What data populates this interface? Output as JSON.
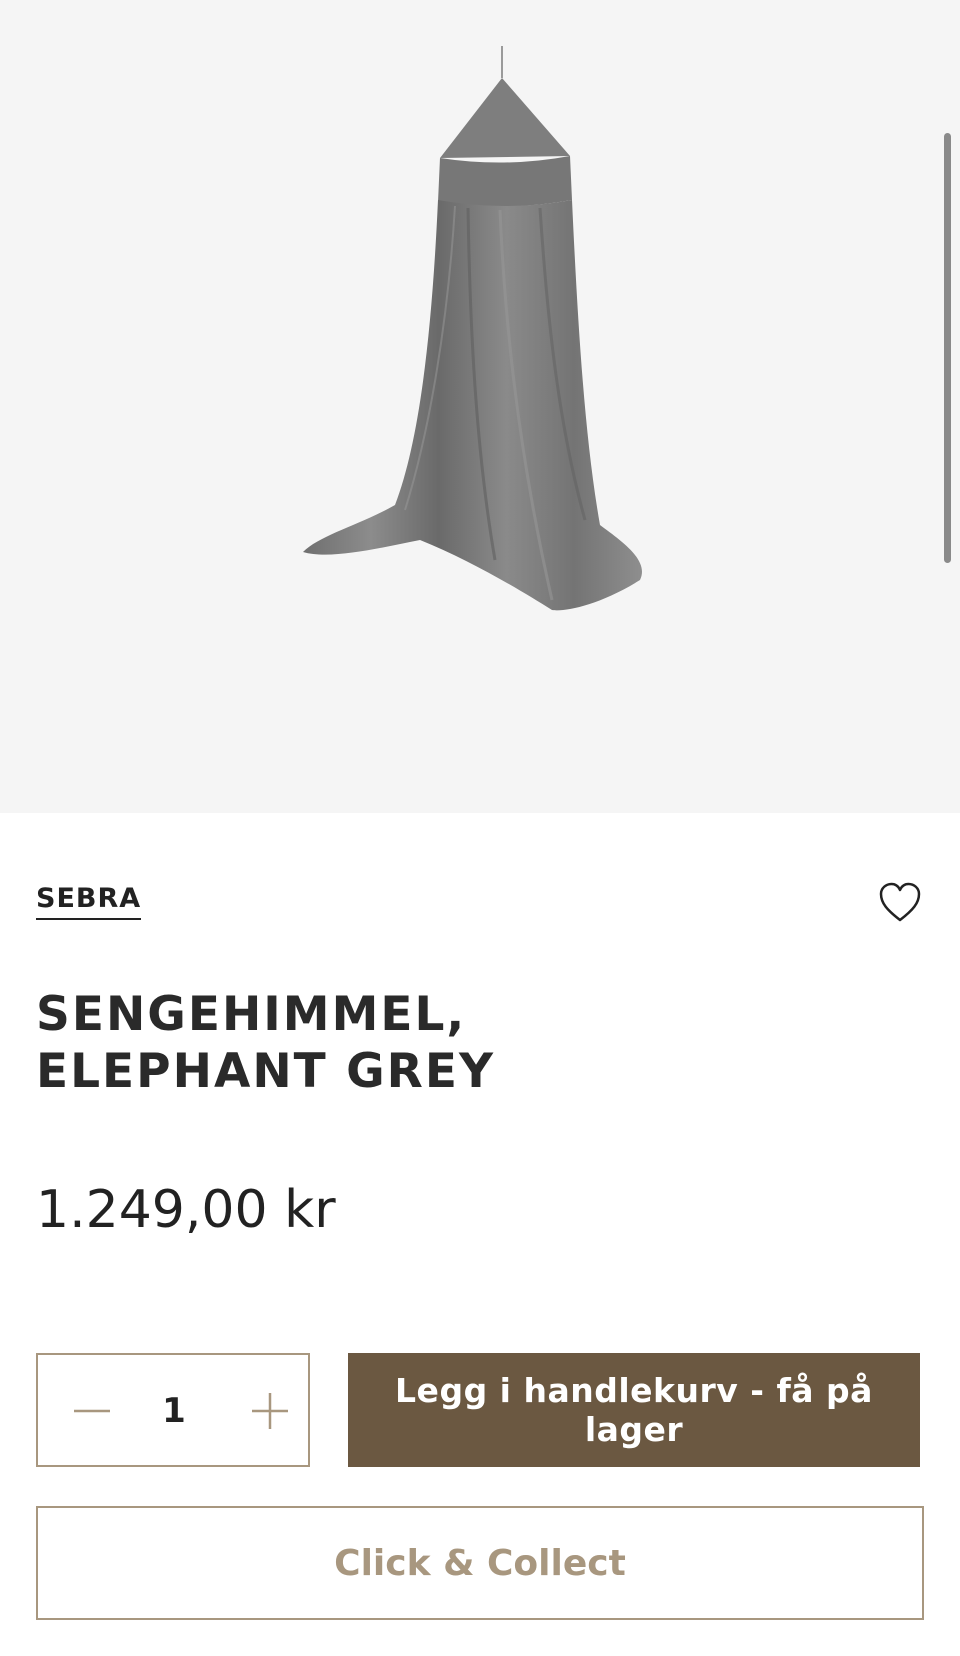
{
  "product": {
    "brand": "SEBRA",
    "title_line1": "SENGEHIMMEL,",
    "title_line2": "ELEPHANT GREY",
    "price": "1.249,00 kr",
    "image_icon": "bed-canopy-image"
  },
  "quantity": {
    "value": "1",
    "minus_icon": "minus-icon",
    "plus_icon": "plus-icon"
  },
  "actions": {
    "add_to_cart_label": "Legg i handlekurv - få på lager",
    "click_collect_label": "Click & Collect",
    "favorite_icon": "heart-icon"
  },
  "colors": {
    "hero_background": "#f5f5f5",
    "primary_button": "#6b5841",
    "accent_tan": "#a8977f",
    "text": "#222222"
  }
}
